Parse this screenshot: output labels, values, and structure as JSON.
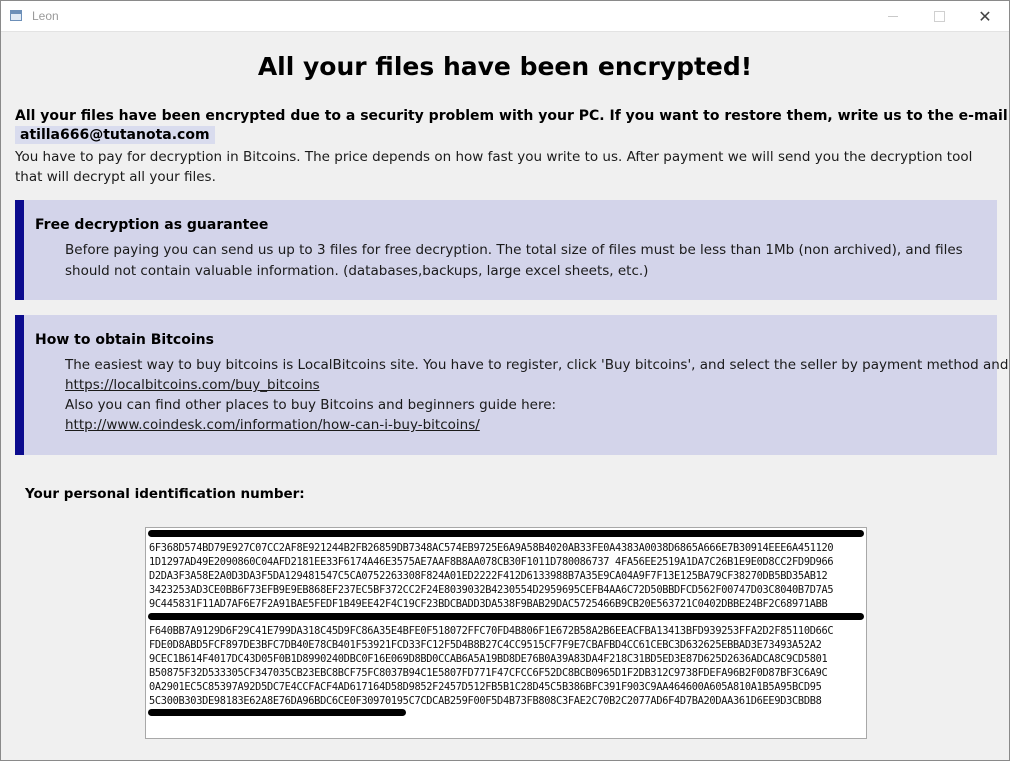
{
  "window": {
    "title": "Leon"
  },
  "headline": "All your files have been encrypted!",
  "intro": {
    "bold": "All your files have been encrypted due to a security problem with your PC. If you want to restore them, write us to the e-mail",
    "email": "atilla666@tutanota.com",
    "text": "You have to pay for decryption in Bitcoins. The price depends on how fast you write to us. After payment we will send you the decryption tool that will decrypt all your files."
  },
  "guarantee": {
    "title": "Free decryption as guarantee",
    "text": "Before paying you can send us up to 3 files for free decryption. The total size of files must be less than 1Mb (non archived), and files should not contain valuable information. (databases,backups, large excel sheets, etc.)"
  },
  "bitcoins": {
    "title": "How to obtain Bitcoins",
    "line1": "The easiest way to buy bitcoins is LocalBitcoins site. You have to register, click 'Buy bitcoins', and select the seller by payment method and price.",
    "link1": "https://localbitcoins.com/buy_bitcoins",
    "line2": "Also you can find other places to buy Bitcoins and beginners guide here:",
    "link2": "http://www.coindesk.com/information/how-can-i-buy-bitcoins/"
  },
  "id_label": "Your personal identification number:",
  "id_lines": [
    "6F368D574BD79E927C07CC2AF8E921244B2FB26859DB7348AC574EB9725E6A9A58B4020AB33FE0A4383A0038D6865A666E7B30914EEE6A451120",
    "1D1297AD49E2090860C04AFD2181EE33F6174A46E3575AE7AAF8B8AA078CB30F1011D780086737 4FA56EE2519A1DA7C26B1E9E0D8CC2FD9D966",
    "D2DA3F3A58E2A0D3DA3F5DA129481547C5CA0752263308F824A01ED2222F412D6133988B7A35E9CA04A9F7F13E125BA79CF38270DB5BD35AB12",
    "3423253AD3CE0BB6F73EFB9E9EB868EF237EC5BF372CC2F24E8039032B4230554D2959695CEFB4AA6C72D50BBDFCD562F00747D03C8040B7D7A5",
    "9C445831F11AD7AF6E7F2A91BAE5FEDF1B49EE42F4C19CF23BDCBADD3DA538F9BAB29DAC5725466B9CB20E563721C0402DBBE24BF2C68971ABB",
    "F640BB7A9129D6F29C41E799DA318C45D9FC86A35E4BFE0F518072FFC70FD4B806F1E672B58A2B6EEACFBA13413BFD939253FFA2D2F85110D66C",
    "FDE0D8ABD5FCF897DE3BFC7DB40E78CB401F53921FCD33FC12F5D4B8B27C4CC9515CF7F9E7CBAFBD4CC61CEBC3D632625EBBAD3E73493A52A2",
    "9CEC1B614F4017DC43D05F0B1D8990240DBC0F16E069D8BD0CCAB6A5A19BD8DE76B0A39A83DA4F218C31BD5ED3E87D625D2636ADCA8C9CD5801",
    "B50875F32D533305CF347035CB23EBC8BCF75FC8037B94C1E5807FD771F47CFCC6F52DC8BCB0965D1F2DB312C9738FDEFA96B2F0D87BF3C6A9C",
    "0A2901EC5C85397A92D5DC7E4CCFACF4AD617164D58D9852F2457D512FB5B1C28D45C5B386BFC391F903C9AA464600A605A810A1B5A95BCD95",
    "5C300B303DE98183E62A8E76DA96BDC6CE0F30970195C7CDCAB259F00F5D4B73FB808C3FAE2C70B2C2077AD6F4D7BA20DAA361D6EE9D3CBDB8"
  ]
}
